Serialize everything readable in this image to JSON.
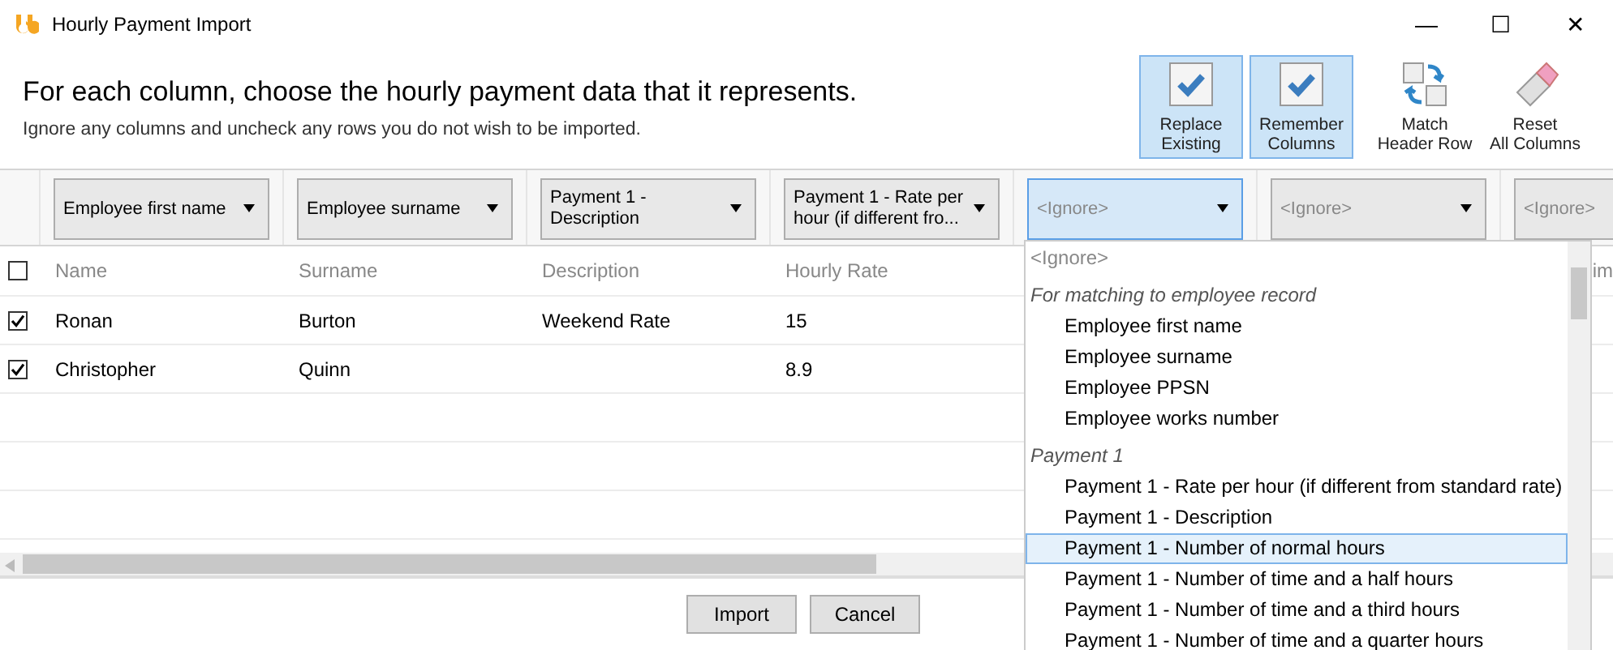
{
  "window": {
    "title": "Hourly Payment Import",
    "controls": [
      "—",
      "☐",
      "✕"
    ]
  },
  "header": {
    "heading": "For each column, choose the hourly payment data that it represents.",
    "subtext": "Ignore any columns and uncheck any rows you do not wish to be imported."
  },
  "toolbar": [
    {
      "kind": "toggle",
      "label": "Replace Existing",
      "checked": true
    },
    {
      "kind": "toggle",
      "label": "Remember Columns",
      "checked": true
    },
    {
      "kind": "match",
      "label": "Match Header Row"
    },
    {
      "kind": "reset",
      "label": "Reset All Columns"
    }
  ],
  "column_selectors": [
    {
      "value": "Employee first name",
      "ignored": false,
      "selected": false
    },
    {
      "value": "Employee surname",
      "ignored": false,
      "selected": false
    },
    {
      "value": "Payment 1 - Description",
      "ignored": false,
      "selected": false
    },
    {
      "value": "Payment 1 - Rate per hour (if different fro...",
      "ignored": false,
      "selected": false
    },
    {
      "value": "<Ignore>",
      "ignored": true,
      "selected": true
    },
    {
      "value": "<Ignore>",
      "ignored": true,
      "selected": false
    },
    {
      "value": "<Ignore>",
      "ignored": true,
      "selected": false
    }
  ],
  "table": {
    "all_checked": false,
    "columns": [
      "Name",
      "Surname",
      "Description",
      "Hourly Rate"
    ],
    "column_7": "im",
    "rows": [
      {
        "checked": true,
        "cells": [
          "Ronan",
          "Burton",
          "Weekend Rate",
          "15"
        ]
      },
      {
        "checked": true,
        "cells": [
          "Christopher",
          "Quinn",
          "",
          "8.9"
        ]
      }
    ]
  },
  "dropdown": [
    {
      "kind": "placeholder",
      "label": "<Ignore>",
      "selected": false
    },
    {
      "kind": "group",
      "label": "For matching to employee record"
    },
    {
      "kind": "option",
      "label": "Employee first name",
      "selected": false
    },
    {
      "kind": "option",
      "label": "Employee surname",
      "selected": false
    },
    {
      "kind": "option",
      "label": "Employee PPSN",
      "selected": false
    },
    {
      "kind": "option",
      "label": "Employee works number",
      "selected": false
    },
    {
      "kind": "group",
      "label": "Payment 1"
    },
    {
      "kind": "option",
      "label": "Payment 1 - Rate per hour (if different from standard rate)",
      "selected": false
    },
    {
      "kind": "option",
      "label": "Payment 1 - Description",
      "selected": false
    },
    {
      "kind": "option",
      "label": "Payment 1 - Number of normal hours",
      "selected": true
    },
    {
      "kind": "option",
      "label": "Payment 1 - Number of time and a half hours",
      "selected": false
    },
    {
      "kind": "option",
      "label": "Payment 1 - Number of time and a third hours",
      "selected": false
    },
    {
      "kind": "option",
      "label": "Payment 1 - Number of time and a quarter hours",
      "selected": false
    }
  ],
  "buttons": [
    "Import",
    "Cancel"
  ]
}
